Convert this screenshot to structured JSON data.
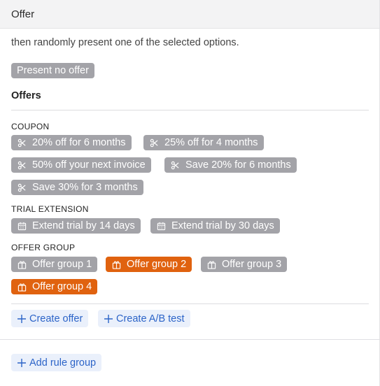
{
  "header": {
    "title": "Offer"
  },
  "description": "then randomly present one of the selected options.",
  "no_offer": {
    "label": "Present no offer"
  },
  "offers_section": {
    "title": "Offers"
  },
  "categories": {
    "coupon": {
      "label": "COUPON",
      "items": [
        {
          "label": "20% off for 6 months",
          "icon": "scissors-icon",
          "selected": false
        },
        {
          "label": "25% off for 4 months",
          "icon": "scissors-icon",
          "selected": false
        },
        {
          "label": "50% off your next invoice",
          "icon": "scissors-icon",
          "selected": false
        },
        {
          "label": "Save 20% for 6 months",
          "icon": "scissors-icon",
          "selected": false
        },
        {
          "label": "Save 30% for 3 months",
          "icon": "scissors-icon",
          "selected": false
        }
      ]
    },
    "trial_extension": {
      "label": "TRIAL EXTENSION",
      "items": [
        {
          "label": "Extend trial by 14 days",
          "icon": "calendar-icon",
          "selected": false
        },
        {
          "label": "Extend trial by 30 days",
          "icon": "calendar-icon",
          "selected": false
        }
      ]
    },
    "offer_group": {
      "label": "OFFER GROUP",
      "items": [
        {
          "label": "Offer group 1",
          "icon": "gift-box-icon",
          "selected": false
        },
        {
          "label": "Offer group 2",
          "icon": "gift-box-icon",
          "selected": true
        },
        {
          "label": "Offer group 3",
          "icon": "gift-box-icon",
          "selected": false
        },
        {
          "label": "Offer group 4",
          "icon": "gift-box-icon",
          "selected": true
        }
      ]
    }
  },
  "actions": {
    "create_offer": "Create offer",
    "create_ab_test": "Create A/B test",
    "add_rule_group": "Add rule group"
  },
  "colors": {
    "chip_default": "#a3a3a8",
    "chip_selected": "#e0620f",
    "button_bg": "#eaf0fb",
    "button_text": "#2c64c8"
  }
}
